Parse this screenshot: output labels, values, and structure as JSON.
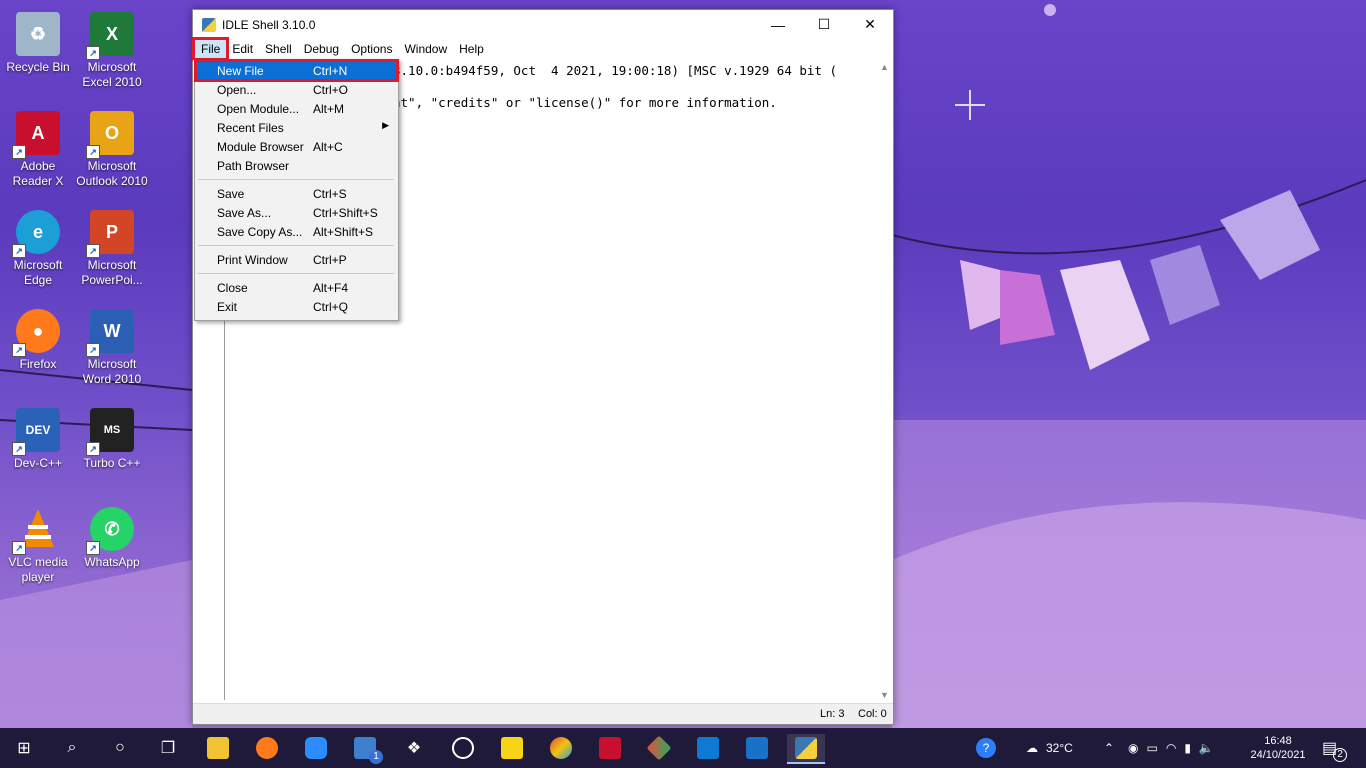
{
  "window": {
    "title": "IDLE Shell 3.10.0",
    "controls": {
      "minimize": "—",
      "maximize": "☐",
      "close": "✕"
    }
  },
  "menubar": [
    "File",
    "Edit",
    "Shell",
    "Debug",
    "Options",
    "Window",
    "Help"
  ],
  "editor": {
    "line1": "3.10.0:b494f59, Oct  4 2021, 19:00:18) [MSC v.1929 64 bit (",
    "line2": "ht\", \"credits\" or \"license()\" for more information."
  },
  "file_menu": [
    {
      "label": "New File",
      "accel": "Ctrl+N",
      "selected": true
    },
    {
      "label": "Open...",
      "accel": "Ctrl+O"
    },
    {
      "label": "Open Module...",
      "accel": "Alt+M"
    },
    {
      "label": "Recent Files",
      "accel": "",
      "submenu": "▶"
    },
    {
      "label": "Module Browser",
      "accel": "Alt+C"
    },
    {
      "label": "Path Browser",
      "accel": ""
    },
    {
      "label": "Save",
      "accel": "Ctrl+S"
    },
    {
      "label": "Save As...",
      "accel": "Ctrl+Shift+S"
    },
    {
      "label": "Save Copy As...",
      "accel": "Alt+Shift+S"
    },
    {
      "label": "Print Window",
      "accel": "Ctrl+P"
    },
    {
      "label": "Close",
      "accel": "Alt+F4"
    },
    {
      "label": "Exit",
      "accel": "Ctrl+Q"
    }
  ],
  "status": {
    "line": "Ln: 3",
    "col": "Col: 0"
  },
  "desktop_icons": [
    {
      "label": "Recycle Bin",
      "icon": "recycle-bin-icon",
      "color": "#9fb6c8"
    },
    {
      "label": "Microsoft Excel 2010",
      "icon": "excel-icon",
      "color": "#1f7a3a"
    },
    {
      "label": "Adobe Reader X",
      "icon": "adobe-reader-icon",
      "color": "#c8102e"
    },
    {
      "label": "Microsoft Outlook 2010",
      "icon": "outlook-icon",
      "color": "#e8a317"
    },
    {
      "label": "Microsoft Edge",
      "icon": "edge-icon",
      "color": "#1b9fd6"
    },
    {
      "label": "Microsoft PowerPoi...",
      "icon": "powerpoint-icon",
      "color": "#d24625"
    },
    {
      "label": "Firefox",
      "icon": "firefox-icon",
      "color": "#ff7a1a"
    },
    {
      "label": "Microsoft Word 2010",
      "icon": "word-icon",
      "color": "#2b5fb3"
    },
    {
      "label": "Dev-C++",
      "icon": "dev-cpp-icon",
      "color": "#2a62b8"
    },
    {
      "label": "Turbo C++",
      "icon": "turbo-cpp-icon",
      "color": "#222222"
    },
    {
      "label": "VLC media player",
      "icon": "vlc-icon",
      "color": "#f08a00"
    },
    {
      "label": "WhatsApp",
      "icon": "whatsapp-icon",
      "color": "#25d366"
    }
  ],
  "taskbar": {
    "weather": "32°C",
    "time": "16:48",
    "date": "24/10/2021",
    "notifications": "2",
    "mail_badge": "1"
  }
}
